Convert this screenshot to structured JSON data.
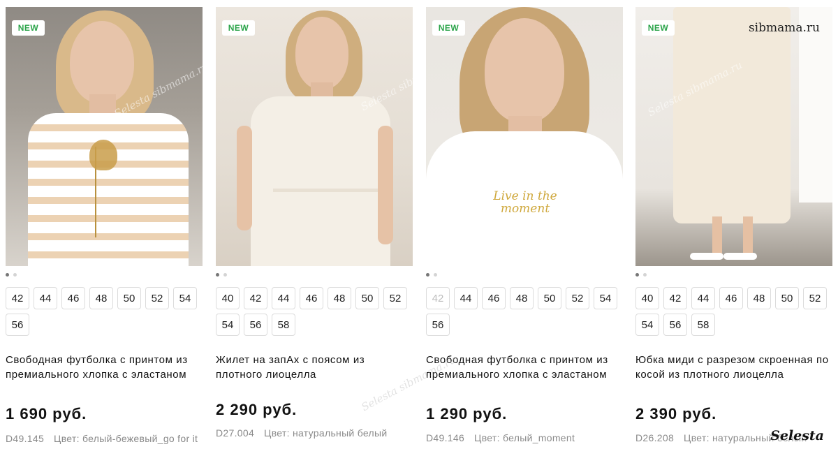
{
  "site_watermark": "sibmama.ru",
  "corner_watermark": "Selesta",
  "photo_watermark": "Selesta sibmama.ru",
  "badge_label": "NEW",
  "products": [
    {
      "badge": "NEW",
      "image": "woman in white t-shirt with beige stripes and golden flower print",
      "image_icon": "product-photo",
      "sizes": [
        "42",
        "44",
        "46",
        "48",
        "50",
        "52",
        "54",
        "56"
      ],
      "disabled_sizes": [],
      "name": "Свободная футболка с принтом из премиального хлопка с эластаном",
      "price": "1 690 руб.",
      "sku": "D49.145",
      "color": "Цвет: белый-бежевый_go for it"
    },
    {
      "badge": "NEW",
      "image": "woman in cream wrap vest with belt",
      "image_icon": "product-photo",
      "sizes": [
        "40",
        "42",
        "44",
        "46",
        "48",
        "50",
        "52",
        "54",
        "56",
        "58"
      ],
      "disabled_sizes": [],
      "name": "Жилет на запАх с поясом из плотного лиоцелла",
      "price": "2 290 руб.",
      "sku": "D27.004",
      "color": "Цвет: натуральный белый"
    },
    {
      "badge": "NEW",
      "image": "woman in white t-shirt with Live in the moment print",
      "image_icon": "product-photo",
      "print_text": "Live in the moment",
      "sizes": [
        "42",
        "44",
        "46",
        "48",
        "50",
        "52",
        "54",
        "56"
      ],
      "disabled_sizes": [
        "42"
      ],
      "name": "Свободная футболка с принтом из премиального хлопка с эластаном",
      "price": "1 290 руб.",
      "sku": "D49.146",
      "color": "Цвет: белый_moment"
    },
    {
      "badge": "NEW",
      "image": "woman in cream bias-cut midi skirt and white heeled sandals",
      "image_icon": "product-photo",
      "sizes": [
        "40",
        "42",
        "44",
        "46",
        "48",
        "50",
        "52",
        "54",
        "56",
        "58"
      ],
      "disabled_sizes": [],
      "name": "Юбка миди с разрезом скроенная по косой из плотного лиоцелла",
      "price": "2 390 руб.",
      "sku": "D26.208",
      "color": "Цвет: натуральный белый"
    }
  ],
  "colors": {
    "badge_text": "#2ba44a",
    "text": "#111111",
    "muted": "#8a8a8a",
    "size_border": "#dcdcdc"
  }
}
